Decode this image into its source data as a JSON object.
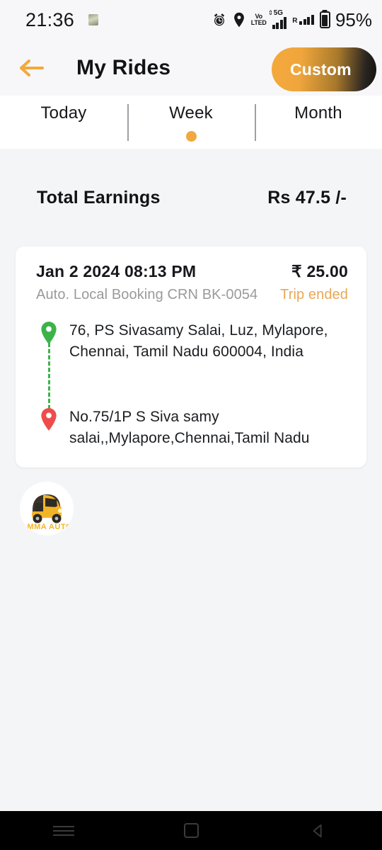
{
  "status_bar": {
    "time": "21:36",
    "notification_icon": "app-notification-icon",
    "alarm_icon": "alarm-clock-icon",
    "location_icon": "location-pin-icon",
    "volte_line1": "Vo",
    "volte_line2": "LTED",
    "network_5g": "5G",
    "roaming_label": "R",
    "battery_percent": "95%"
  },
  "header": {
    "back_icon": "back-arrow-icon",
    "title": "My Rides",
    "custom_button": "Custom",
    "accent_color": "#F4A93C"
  },
  "tabs": [
    {
      "label": "Today",
      "active": false
    },
    {
      "label": "Week",
      "active": true
    },
    {
      "label": "Month",
      "active": false
    }
  ],
  "earnings": {
    "label": "Total Earnings",
    "value": "Rs 47.5 /-"
  },
  "ride": {
    "datetime": "Jan 2 2024 08:13 PM",
    "fare": "₹ 25.00",
    "meta": "Auto. Local Booking CRN BK-0054",
    "status": "Trip ended",
    "status_color": "#E8A855",
    "pickup": {
      "icon": "pickup-pin-icon",
      "color": "#3CB34A",
      "address": "76, PS Sivasamy Salai, Luz, Mylapore, Chennai, Tamil Nadu 600004, India"
    },
    "drop": {
      "icon": "drop-pin-icon",
      "color": "#F04B4B",
      "address": "No.75/1P S Siva samy salai,,Mylapore,Chennai,Tamil Nadu"
    }
  },
  "logo": {
    "name": "amma-auto-logo",
    "text": "AMMA AUTO"
  },
  "nav_bar": {
    "recents": "recents-icon",
    "home": "home-icon",
    "back": "back-icon"
  }
}
